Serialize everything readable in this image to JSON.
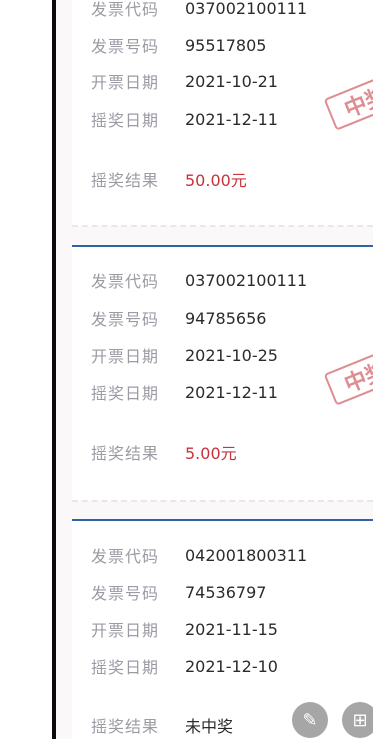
{
  "cards": [
    {
      "rows": [
        {
          "label": "发票代码",
          "value": "037002100111"
        },
        {
          "label": "发票号码",
          "value": "95517805"
        },
        {
          "label": "开票日期",
          "value": "2021-10-21"
        },
        {
          "label": "摇奖日期",
          "value": "2021-12-11"
        }
      ],
      "result": {
        "label": "摇奖结果",
        "value": "50.00元"
      },
      "stamp": "中奖"
    },
    {
      "rows": [
        {
          "label": "发票代码",
          "value": "037002100111"
        },
        {
          "label": "发票号码",
          "value": "94785656"
        },
        {
          "label": "开票日期",
          "value": "2021-10-25"
        },
        {
          "label": "摇奖日期",
          "value": "2021-12-11"
        }
      ],
      "result": {
        "label": "摇奖结果",
        "value": "5.00元"
      },
      "stamp": "中奖"
    },
    {
      "rows": [
        {
          "label": "发票代码",
          "value": "042001800311"
        },
        {
          "label": "发票号码",
          "value": "74536797"
        },
        {
          "label": "开票日期",
          "value": "2021-11-15"
        },
        {
          "label": "摇奖日期",
          "value": "2021-12-10"
        }
      ],
      "result": {
        "label": "摇奖结果",
        "value": "未中奖"
      }
    }
  ],
  "floating_buttons": {
    "edit_icon": "pencil-icon",
    "grid_icon": "grid-icon"
  },
  "colors": {
    "accent_blue": "#2f63a8",
    "win_red": "#c8323a",
    "stamp_red": "#d97a7f"
  }
}
